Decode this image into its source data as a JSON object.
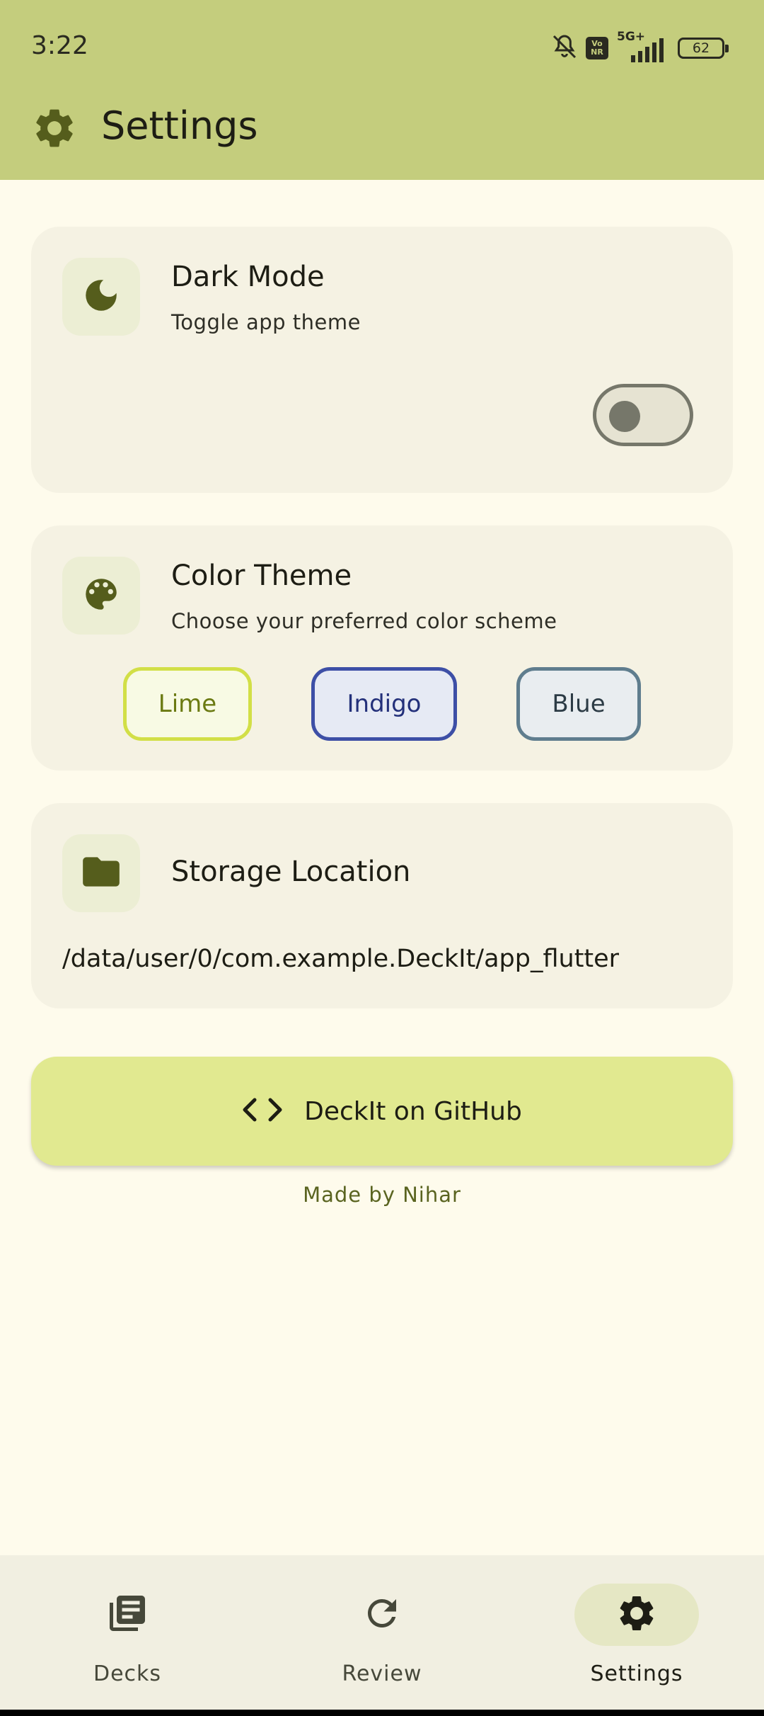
{
  "status_bar": {
    "time": "3:22",
    "network_badge": "5G+",
    "volte_badge_top": "Vo",
    "volte_badge_bottom": "NR",
    "battery": "62",
    "icons": [
      "bell-off-icon",
      "volte-icon",
      "signal-icon",
      "battery-icon"
    ]
  },
  "app_bar": {
    "title": "Settings",
    "icon": "gear-icon"
  },
  "dark_mode": {
    "title": "Dark Mode",
    "subtitle": "Toggle app theme",
    "icon": "moon-icon",
    "enabled": false
  },
  "color_theme": {
    "title": "Color Theme",
    "subtitle": "Choose your preferred color scheme",
    "icon": "palette-icon",
    "options": [
      {
        "label": "Lime",
        "border": "#d2df47",
        "bg": "#f8fae4",
        "text": "#6b7a12"
      },
      {
        "label": "Indigo",
        "border": "#3d4fa6",
        "bg": "#e6eaf4",
        "text": "#23307a"
      },
      {
        "label": "Blue",
        "border": "#5f7d8e",
        "bg": "#e9edf0",
        "text": "#2c3b45"
      }
    ]
  },
  "storage": {
    "title": "Storage Location",
    "icon": "folder-icon",
    "path": "/data/user/0/com.example.DeckIt/app_flutter"
  },
  "github_button": {
    "label": "DeckIt on GitHub",
    "icon": "code-icon"
  },
  "footer": {
    "made_by": "Made by Nihar"
  },
  "nav": {
    "items": [
      {
        "label": "Decks",
        "icon": "decks-icon",
        "active": false
      },
      {
        "label": "Review",
        "icon": "refresh-icon",
        "active": false
      },
      {
        "label": "Settings",
        "icon": "gear-icon",
        "active": true
      }
    ]
  },
  "colors": {
    "accent": "#c4cd7d",
    "icon_olive": "#555d1c",
    "background": "#fefbec",
    "card": "#f5f2e3",
    "button": "#e1e990",
    "nav_active_pill": "#e5e7c4"
  }
}
